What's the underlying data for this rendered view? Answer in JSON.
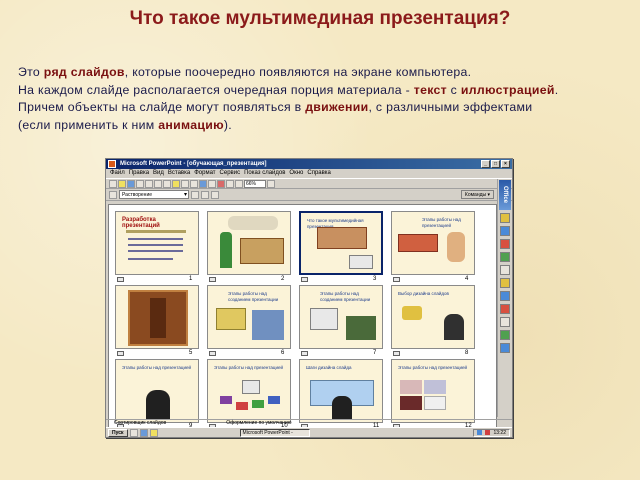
{
  "title": "Что такое  мультимединая  презентация?",
  "intro": {
    "l1_a": "Это ",
    "l1_b": "ряд слайдов",
    "l1_c": ", которые поочередно  появляются на  экране компьютера.",
    "l2_a": "На каждом слайде располагается очередная порция материала - ",
    "l2_b": "текст",
    "l2_c": " с ",
    "l2_d": "иллюстрацией",
    "l2_e": ".",
    "l3_a": "Причем объекты на слайде могут появляться в ",
    "l3_b": "движении",
    "l3_c": ", с различными эффектами",
    "l4_a": "(если применить к ним ",
    "l4_b": "анимацию",
    "l4_c": ")."
  },
  "window": {
    "title": "Microsoft PowerPoint - [обучающая_презентация]",
    "menu": [
      "Файл",
      "Правка",
      "Вид",
      "Вставка",
      "Формат",
      "Сервис",
      "Показ слайдов",
      "Окно",
      "Справка"
    ],
    "zoom": "66%",
    "transition_select": "Растворение",
    "commands_button": "Команды ▾",
    "office_label": "Office",
    "status_left": "Сортировщик слайдов",
    "status_right": "Оформление по умолчанию",
    "taskbar": {
      "start": "Пуск",
      "task": "Microsoft PowerPoint -",
      "clock": "13:22"
    },
    "slide_numbers": [
      "1",
      "2",
      "3",
      "4",
      "5",
      "6",
      "7",
      "8",
      "9",
      "10",
      "11",
      "12"
    ],
    "slide_texts": {
      "s1": "Разработка презентаций",
      "s3": "Что такое мультимедийная презентация",
      "s4": "Этапы работы над презентацией",
      "s5": "",
      "s6": "Этапы работы над созданием презентации",
      "s7": "Этапы работы над созданием презентации",
      "s8": "Выбор дизайна слайдов",
      "s9": "Этапы работы над презентацией",
      "s10": "Этапы работы над презентацией",
      "s11": "Шаги дизайна слайда",
      "s12": "Этапы работы над презентацией"
    }
  },
  "colors": {
    "title": "#8b1a1a",
    "body_text": "#1a1a4a",
    "emphasis": "#7a1010",
    "background": "#f5e9c4"
  }
}
